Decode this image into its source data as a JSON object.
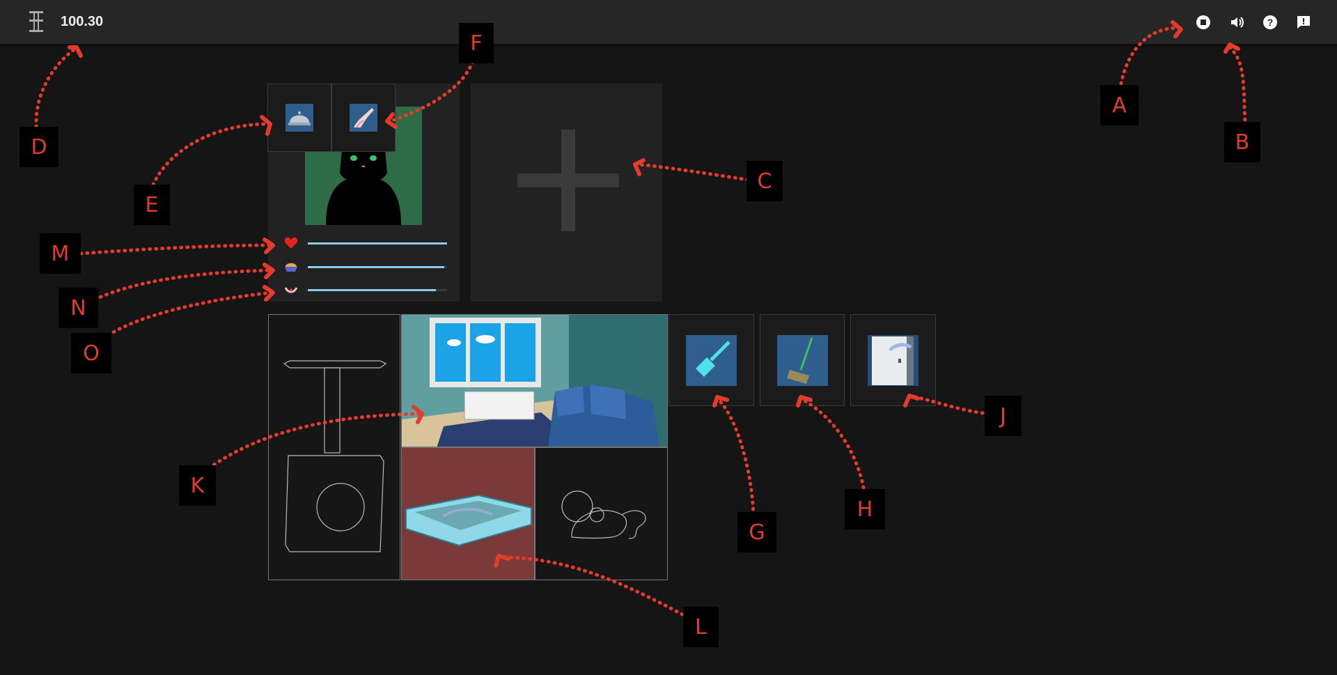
{
  "topbar": {
    "logo_icon": "cat-tree-logo-icon",
    "money": "100.30",
    "buttons": [
      {
        "name": "stop-button",
        "icon": "stop-icon"
      },
      {
        "name": "sound-button",
        "icon": "speaker-icon"
      },
      {
        "name": "help-button",
        "icon": "help-icon"
      },
      {
        "name": "feedback-button",
        "icon": "feedback-icon"
      }
    ]
  },
  "cat_panel": {
    "actions": [
      {
        "name": "feed-button",
        "icon": "food-bowl-icon"
      },
      {
        "name": "pet-button",
        "icon": "petting-hand-icon"
      }
    ],
    "portrait": "black-cat-icon"
  },
  "add_cat_slot": {
    "icon": "plus-icon"
  },
  "stats": [
    {
      "name": "health",
      "icon": "heart-icon",
      "level": 1.0
    },
    {
      "name": "hunger",
      "icon": "food-bowl-icon",
      "level": 0.98
    },
    {
      "name": "happiness",
      "icon": "mouth-icon",
      "level": 0.92
    }
  ],
  "rooms": [
    {
      "name": "cat-tree",
      "icon": "cat-tree-icon"
    },
    {
      "name": "living-room",
      "icon": "living-room-icon"
    },
    {
      "name": "litter-box",
      "icon": "litter-box-icon"
    },
    {
      "name": "toy-mouse",
      "icon": "toy-mouse-icon"
    }
  ],
  "tools": [
    {
      "name": "scoop-button",
      "icon": "scoop-icon"
    },
    {
      "name": "broom-button",
      "icon": "broom-icon"
    },
    {
      "name": "door-button",
      "icon": "door-icon"
    }
  ],
  "callouts": [
    "A",
    "B",
    "C",
    "D",
    "E",
    "F",
    "G",
    "H",
    "J",
    "K",
    "L",
    "M",
    "N",
    "O"
  ],
  "colors": {
    "accent": "#e53b2c",
    "bar": "#8ecbef",
    "tile": "#2f5d8c",
    "litter_room": "#7a3a3a"
  }
}
